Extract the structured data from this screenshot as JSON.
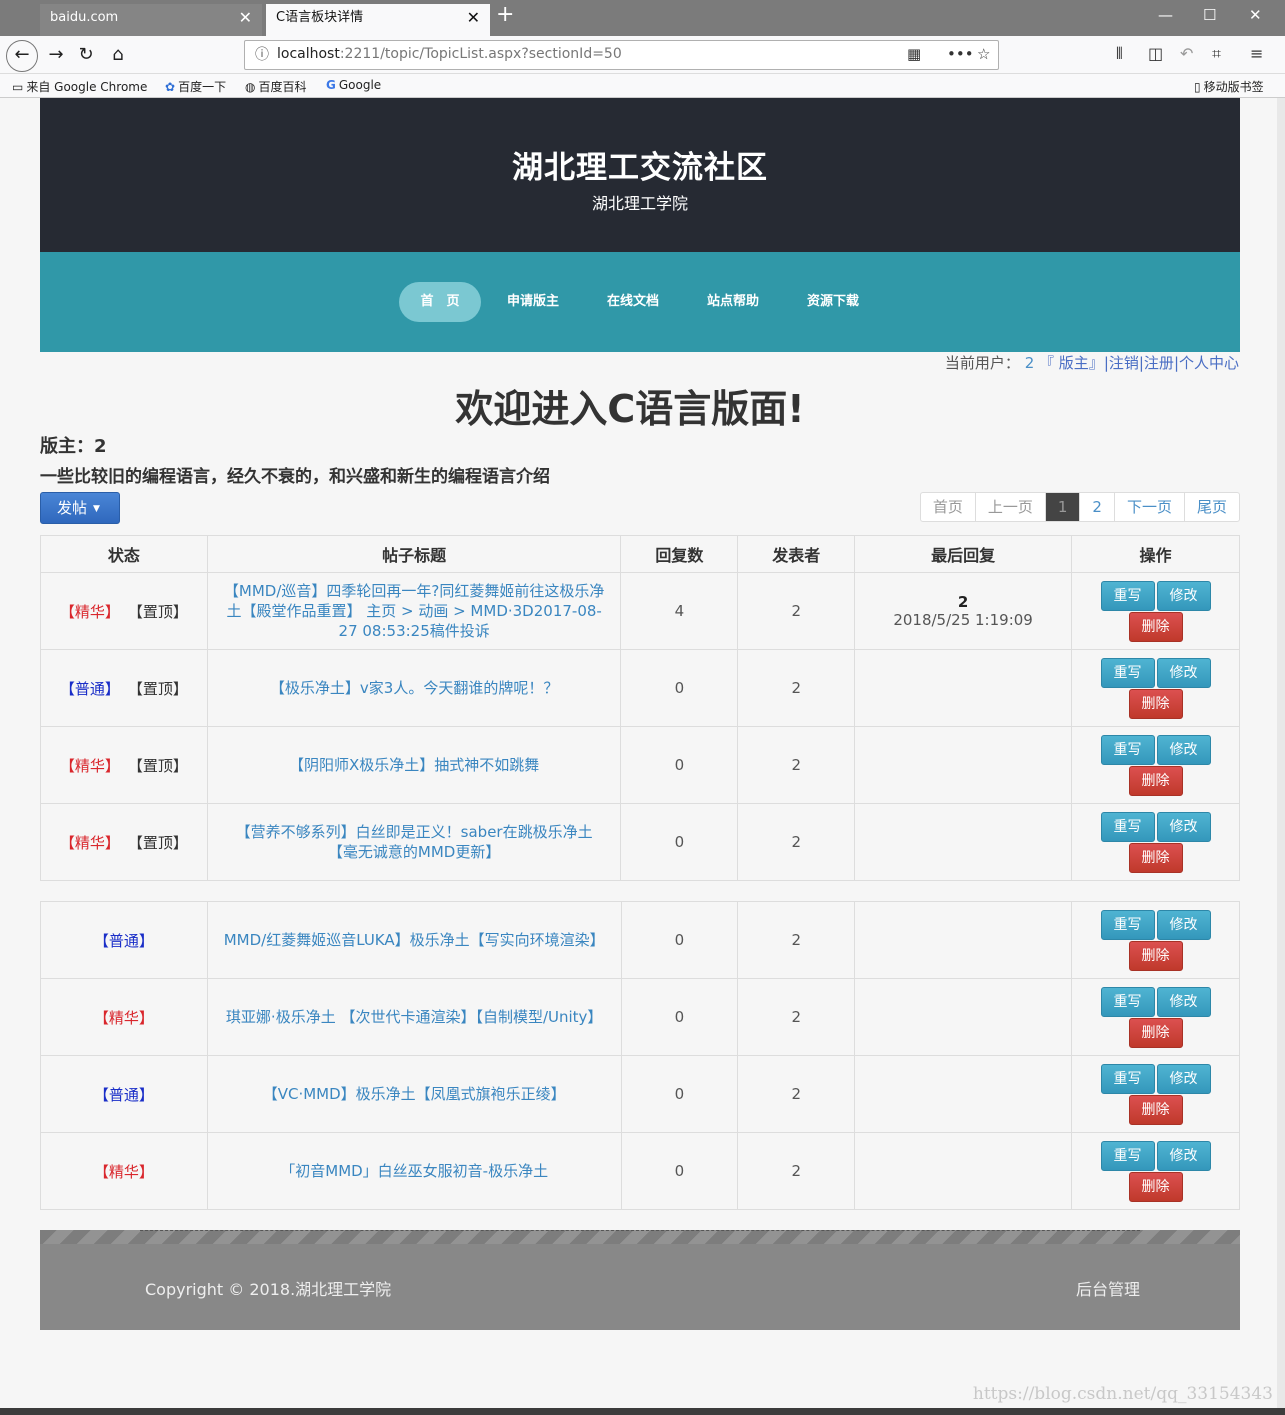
{
  "browser": {
    "tabs": [
      {
        "label": "baidu.com",
        "active": false
      },
      {
        "label": "C语言板块详情",
        "active": true
      }
    ],
    "url_host": "localhost",
    "url_rest": ":2211/topic/TopicList.aspx?sectionId=50",
    "bookmarks": [
      "来自 Google Chrome",
      "百度一下",
      "百度百科",
      "Google"
    ],
    "mobile_bookmarks": "移动版书签"
  },
  "header": {
    "title": "湖北理工交流社区",
    "subtitle": "湖北理工学院"
  },
  "nav": {
    "items": [
      "首　页",
      "申请版主",
      "在线文档",
      "站点帮助",
      "资源下载"
    ]
  },
  "user": {
    "prefix": "当前用户：",
    "name": "2",
    "role": "『 版主』",
    "links": [
      "|注销",
      "|注册",
      "|个人中心"
    ]
  },
  "section": {
    "welcome": "欢迎进入C语言版面!",
    "moderator": "版主：2",
    "description": "一些比较旧的编程语言，经久不衰的，和兴盛和新生的编程语言介绍",
    "post_button": "发帖"
  },
  "pager": {
    "first": "首页",
    "prev": "上一页",
    "pages": [
      "1",
      "2"
    ],
    "current": "1",
    "next": "下一页",
    "last": "尾页"
  },
  "table": {
    "columns": [
      "状态",
      "帖子标题",
      "回复数",
      "发表者",
      "最后回复",
      "操作"
    ],
    "buttons": {
      "rewrite": "重写",
      "edit": "修改",
      "delete": "删除"
    },
    "pinned": [
      {
        "status": "【精华】",
        "status_color": "#d9262c",
        "pin": "【置顶】",
        "title": "【MMD/巡音】四季轮回再一年?同红菱舞姬前往这极乐净土【殿堂作品重置】 主页 > 动画 > MMD·3D2017-08-27 08:53:25稿件投诉",
        "replies": "4",
        "author": "2",
        "last_name": "2",
        "last_time": "2018/5/25 1:19:09"
      },
      {
        "status": "【普通】",
        "status_color": "#1a2ec8",
        "pin": "【置顶】",
        "title": "【极乐净土】v家3人。今天翻谁的牌呢！？",
        "replies": "0",
        "author": "2",
        "last_name": "",
        "last_time": ""
      },
      {
        "status": "【精华】",
        "status_color": "#d9262c",
        "pin": "【置顶】",
        "title": "【阴阳师X极乐净土】抽式神不如跳舞",
        "replies": "0",
        "author": "2",
        "last_name": "",
        "last_time": ""
      },
      {
        "status": "【精华】",
        "status_color": "#d9262c",
        "pin": "【置顶】",
        "title": "【营养不够系列】白丝即是正义！saber在跳极乐净土【毫无诚意的MMD更新】",
        "replies": "0",
        "author": "2",
        "last_name": "",
        "last_time": ""
      }
    ],
    "normal": [
      {
        "status": "【普通】",
        "status_color": "#1a2ec8",
        "title": "MMD/红菱舞姬巡音LUKA】极乐净土【写实向环境渲染】",
        "replies": "0",
        "author": "2"
      },
      {
        "status": "【精华】",
        "status_color": "#d9262c",
        "title": "琪亚娜·极乐净土 【次世代卡通渲染】【自制模型/Unity】",
        "replies": "0",
        "author": "2"
      },
      {
        "status": "【普通】",
        "status_color": "#1a2ec8",
        "title": "【VC·MMD】极乐净土【凤凰式旗袍乐正绫】",
        "replies": "0",
        "author": "2"
      },
      {
        "status": "【精华】",
        "status_color": "#d9262c",
        "title": "「初音MMD」白丝巫女服初音-极乐净土",
        "replies": "0",
        "author": "2"
      }
    ]
  },
  "footer": {
    "copyright": "Copyright © 2018.湖北理工学院",
    "admin": "后台管理"
  },
  "watermark": "https://blog.csdn.net/qq_33154343",
  "colors": {
    "header_bg": "#262a33",
    "nav_bg": "#3098a8",
    "nav_active": "#7bc8d2",
    "essence": "#d9262c",
    "normal": "#1a2ec8",
    "link": "#3a86c0"
  }
}
